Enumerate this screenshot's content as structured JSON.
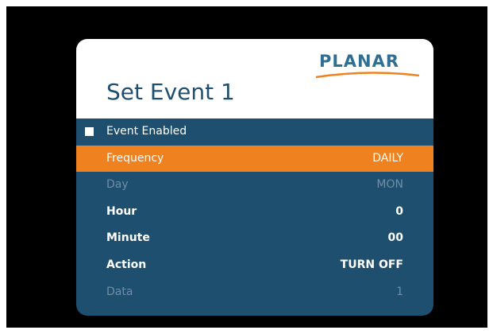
{
  "brand": {
    "logo_text": "PLANAR",
    "accent": "#f0811f",
    "panel": "#1f4f6f"
  },
  "dialog": {
    "title": "Set Event 1"
  },
  "menu": {
    "enabled": {
      "label": "Event Enabled",
      "checked": true
    },
    "frequency": {
      "label": "Frequency",
      "value": "DAILY",
      "selected": true
    },
    "day": {
      "label": "Day",
      "value": "MON",
      "disabled": true
    },
    "hour": {
      "label": "Hour",
      "value": "0"
    },
    "minute": {
      "label": "Minute",
      "value": "00"
    },
    "action": {
      "label": "Action",
      "value": "TURN OFF"
    },
    "data": {
      "label": "Data",
      "value": "1",
      "disabled": true
    }
  }
}
